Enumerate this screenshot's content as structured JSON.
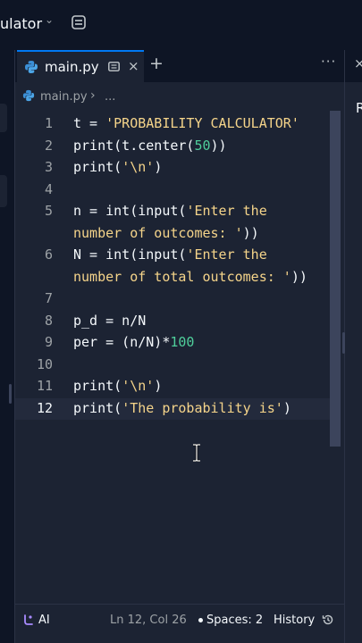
{
  "topbar": {
    "app_title": "ulator",
    "chevron": "⌄",
    "panel_icon": "panel-icon"
  },
  "tab": {
    "label": "main.py",
    "close": "×",
    "add": "+",
    "more": "···"
  },
  "breadcrumb": {
    "file": "main.py",
    "sep": "›",
    "more": "..."
  },
  "code": {
    "lines": [
      {
        "n": "1",
        "parts": [
          [
            "t = ",
            ""
          ],
          [
            "'PROBABILITY CALCULATOR'",
            "str"
          ]
        ]
      },
      {
        "n": "2",
        "parts": [
          [
            "print(t.center(",
            ""
          ],
          [
            "50",
            "num"
          ],
          [
            "))",
            ""
          ]
        ]
      },
      {
        "n": "3",
        "parts": [
          [
            "print(",
            ""
          ],
          [
            "'\\n'",
            "str"
          ],
          [
            ")",
            ""
          ]
        ]
      },
      {
        "n": "4",
        "parts": []
      },
      {
        "n": "5",
        "parts": [
          [
            "n = int(input(",
            ""
          ],
          [
            "'Enter the",
            "str"
          ]
        ]
      },
      {
        "n": "",
        "parts": [
          [
            "number of outcomes: '",
            "str"
          ],
          [
            "))",
            ""
          ]
        ]
      },
      {
        "n": "6",
        "parts": [
          [
            "N = int(input(",
            ""
          ],
          [
            "'Enter the",
            "str"
          ]
        ]
      },
      {
        "n": "",
        "parts": [
          [
            "number of total outcomes: '",
            "str"
          ],
          [
            "))",
            ""
          ]
        ]
      },
      {
        "n": "7",
        "parts": []
      },
      {
        "n": "8",
        "parts": [
          [
            "p_d = n/N",
            ""
          ]
        ]
      },
      {
        "n": "9",
        "parts": [
          [
            "per = (n/N)*",
            ""
          ],
          [
            "100",
            "num"
          ]
        ]
      },
      {
        "n": "10",
        "parts": []
      },
      {
        "n": "11",
        "parts": [
          [
            "print(",
            ""
          ],
          [
            "'\\n'",
            "str"
          ],
          [
            ")",
            ""
          ]
        ]
      },
      {
        "n": "12",
        "parts": [
          [
            "print(",
            ""
          ],
          [
            "'The probability is'",
            "str"
          ],
          [
            ")",
            ""
          ]
        ]
      }
    ],
    "active_line": "12"
  },
  "statusbar": {
    "ai": "AI",
    "position": "Ln 12, Col 26",
    "spaces": "Spaces: 2",
    "history": "History"
  },
  "right_pane": {
    "close": "×",
    "text": "R"
  },
  "colors": {
    "background": "#1c2333",
    "chrome": "#0e1525",
    "accent": "#0079f2",
    "string": "#f5d48a",
    "number": "#4fcf9b"
  }
}
